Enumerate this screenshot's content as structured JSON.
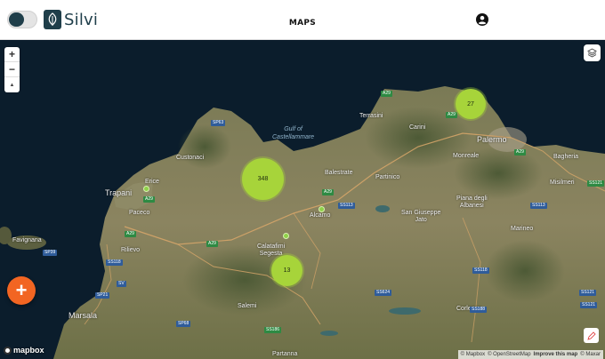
{
  "header": {
    "brand": "Silvi",
    "title": "MAPS",
    "toggle_icon": "theme-toggle",
    "account_icon": "account-circle-icon"
  },
  "map_controls": {
    "zoom_in": "+",
    "zoom_out": "−",
    "compass": "▲",
    "layers_icon": "layers-icon"
  },
  "clusters": [
    {
      "label": "348"
    },
    {
      "label": "27"
    },
    {
      "label": "13"
    }
  ],
  "places": {
    "terrasini": "Terrasini",
    "carini": "Carini",
    "palermo": "Palermo",
    "custonaci": "Custonaci",
    "balestrate": "Balestrate",
    "partinico": "Partinico",
    "monreale": "Monreale",
    "bagheria": "Bagheria",
    "misilmeri": "Misilmeri",
    "trapani": "Trapani",
    "erice": "Erice",
    "paceco": "Paceco",
    "alcamo": "Alcamo",
    "san_giuseppe": "San Giuseppe\nJato",
    "piana": "Piana degli\nAlbanesi",
    "favignana": "Favignana",
    "rilievo": "Rilievo",
    "calatafimi": "Calatafimi\nSegesta",
    "marineo": "Marineo",
    "salemi": "Salemi",
    "corleone": "Corleone",
    "marsala": "Marsala",
    "partanna": "Partanna"
  },
  "water_labels": {
    "gulf": "Gulf of\nCastellammare"
  },
  "road_shields": [
    "A29",
    "SP63",
    "A29",
    "A29",
    "A29",
    "SS113",
    "A29",
    "SS113",
    "SP39",
    "A29",
    "SS624",
    "SS118",
    "SS121",
    "SS121",
    "SS121",
    "SS188",
    "SP21",
    "SV",
    "SS118",
    "SP68",
    "A29",
    "SS186"
  ],
  "fab_label": "+",
  "mapbox_logo": "mapbox",
  "attribution": {
    "mapbox": "© Mapbox",
    "osm": "© OpenStreetMap",
    "improve": "Improve this map",
    "maxar": "© Maxar"
  },
  "colors": {
    "brand": "#1f3e4a",
    "cluster": "#a7d43a",
    "fab": "#f26522",
    "sea": "#0b1d2c"
  }
}
